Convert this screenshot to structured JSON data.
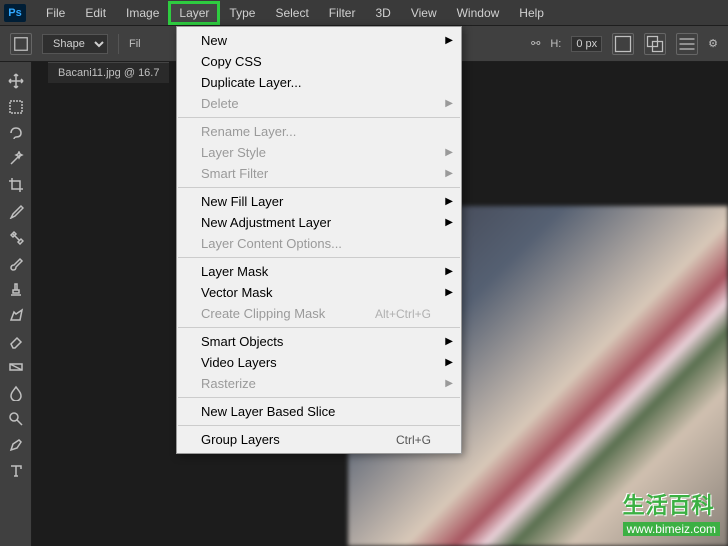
{
  "logo": "Ps",
  "menubar": {
    "items": [
      "File",
      "Edit",
      "Image",
      "Layer",
      "Type",
      "Select",
      "Filter",
      "3D",
      "View",
      "Window",
      "Help"
    ],
    "highlighted_index": 3
  },
  "options_bar": {
    "mode_label": "Shape",
    "fill_label": "Fil",
    "link_label": "H:",
    "link_value": "0 px"
  },
  "document": {
    "tab_label": "Bacani11.jpg @ 16.7"
  },
  "dropdown": {
    "items": [
      {
        "label": "New",
        "submenu": true
      },
      {
        "label": "Copy CSS"
      },
      {
        "label": "Duplicate Layer..."
      },
      {
        "label": "Delete",
        "submenu": true,
        "disabled": true
      },
      {
        "sep": true
      },
      {
        "label": "Rename Layer...",
        "disabled": true
      },
      {
        "label": "Layer Style",
        "submenu": true,
        "disabled": true
      },
      {
        "label": "Smart Filter",
        "submenu": true,
        "disabled": true
      },
      {
        "sep": true
      },
      {
        "label": "New Fill Layer",
        "submenu": true
      },
      {
        "label": "New Adjustment Layer",
        "submenu": true
      },
      {
        "label": "Layer Content Options...",
        "disabled": true
      },
      {
        "sep": true
      },
      {
        "label": "Layer Mask",
        "submenu": true
      },
      {
        "label": "Vector Mask",
        "submenu": true
      },
      {
        "label": "Create Clipping Mask",
        "shortcut": "Alt+Ctrl+G",
        "disabled": true
      },
      {
        "sep": true
      },
      {
        "label": "Smart Objects",
        "submenu": true
      },
      {
        "label": "Video Layers",
        "submenu": true
      },
      {
        "label": "Rasterize",
        "submenu": true,
        "disabled": true
      },
      {
        "sep": true
      },
      {
        "label": "New Layer Based Slice"
      },
      {
        "sep": true
      },
      {
        "label": "Group Layers",
        "shortcut": "Ctrl+G"
      }
    ]
  },
  "tools": [
    "move",
    "marquee",
    "lasso",
    "wand",
    "crop",
    "eyedropper",
    "heal",
    "brush",
    "stamp",
    "history",
    "eraser",
    "gradient",
    "blur",
    "dodge",
    "pen",
    "type"
  ],
  "watermark": {
    "title": "生活百科",
    "url": "www.bimeiz.com"
  }
}
